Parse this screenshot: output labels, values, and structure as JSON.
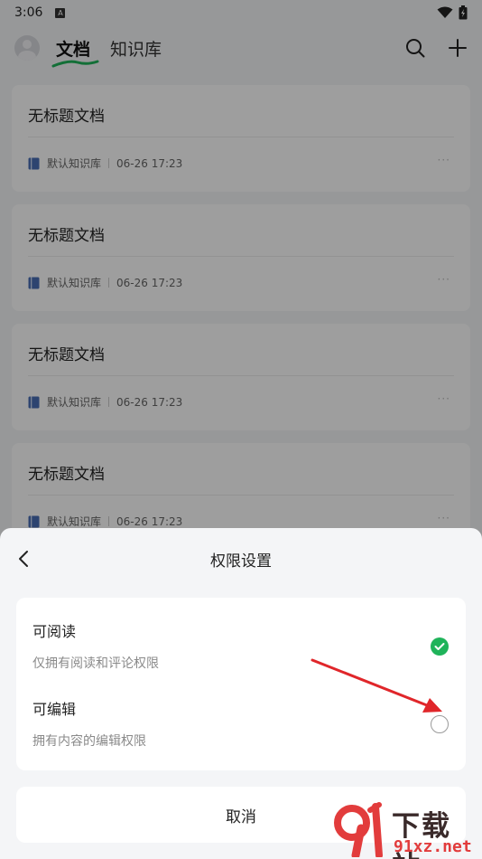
{
  "status_bar": {
    "time": "3:06",
    "badge": "A"
  },
  "nav": {
    "tab_docs": "文档",
    "tab_knowledge": "知识库",
    "icons": [
      "search-icon",
      "plus-icon"
    ]
  },
  "docs": [
    {
      "title": "无标题文档",
      "library": "默认知识库",
      "time": "06-26 17:23"
    },
    {
      "title": "无标题文档",
      "library": "默认知识库",
      "time": "06-26 17:23"
    },
    {
      "title": "无标题文档",
      "library": "默认知识库",
      "time": "06-26 17:23"
    },
    {
      "title": "无标题文档",
      "library": "默认知识库",
      "time": "06-26 17:23"
    }
  ],
  "sheet": {
    "title": "权限设置",
    "options": [
      {
        "label": "可阅读",
        "desc": "仅拥有阅读和评论权限",
        "selected": true
      },
      {
        "label": "可编辑",
        "desc": "拥有内容的编辑权限",
        "selected": false
      }
    ],
    "cancel": "取消"
  },
  "watermark": {
    "text": "下载站",
    "url": "91xz.net"
  },
  "colors": {
    "accent": "#1fb35a",
    "arrow": "#e0262a",
    "book": "#4a6fb5"
  }
}
